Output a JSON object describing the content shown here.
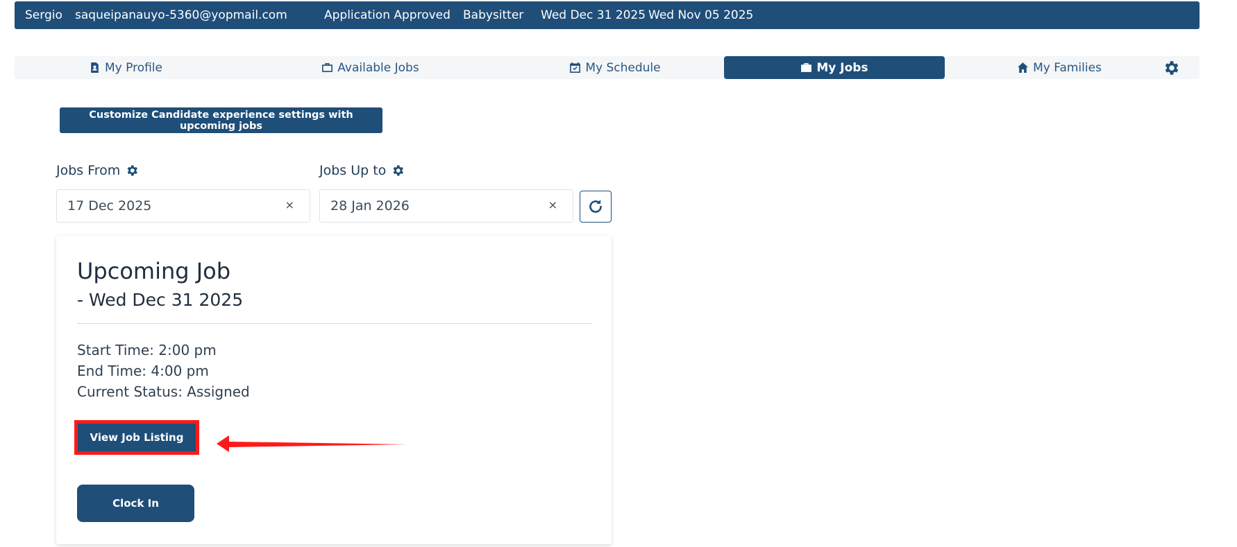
{
  "topbar": {
    "name": "Sergio",
    "email": "saqueipanauyo-5360@yopmail.com",
    "status": "Application Approved",
    "role": "Babysitter",
    "date1": "Wed Dec 31 2025",
    "date2": "Wed Nov 05 2025"
  },
  "nav": {
    "tabs": [
      {
        "label": "My Profile",
        "icon": "profile-icon"
      },
      {
        "label": "Available Jobs",
        "icon": "briefcase-outline-icon"
      },
      {
        "label": "My Schedule",
        "icon": "calendar-check-icon"
      },
      {
        "label": "My Jobs",
        "icon": "briefcase-icon",
        "active": true
      },
      {
        "label": "My Families",
        "icon": "home-icon"
      }
    ],
    "settings_icon": "gear-icon"
  },
  "customize_button": "Customize Candidate experience settings with upcoming jobs",
  "filters": {
    "from_label": "Jobs From",
    "from_value": "17 Dec 2025",
    "to_label": "Jobs Up to",
    "to_value": "28 Jan 2026",
    "clear_glyph": "×"
  },
  "job_card": {
    "title": "Upcoming Job",
    "date": "- Wed Dec 31 2025",
    "start_time": "Start Time: 2:00 pm",
    "end_time": "End Time: 4:00 pm",
    "status": "Current Status: Assigned",
    "view_button": "View Job Listing",
    "clock_button": "Clock In"
  },
  "colors": {
    "primary": "#1f4e79",
    "highlight": "#ff1a1a",
    "nav_background": "#f4f6f8"
  }
}
